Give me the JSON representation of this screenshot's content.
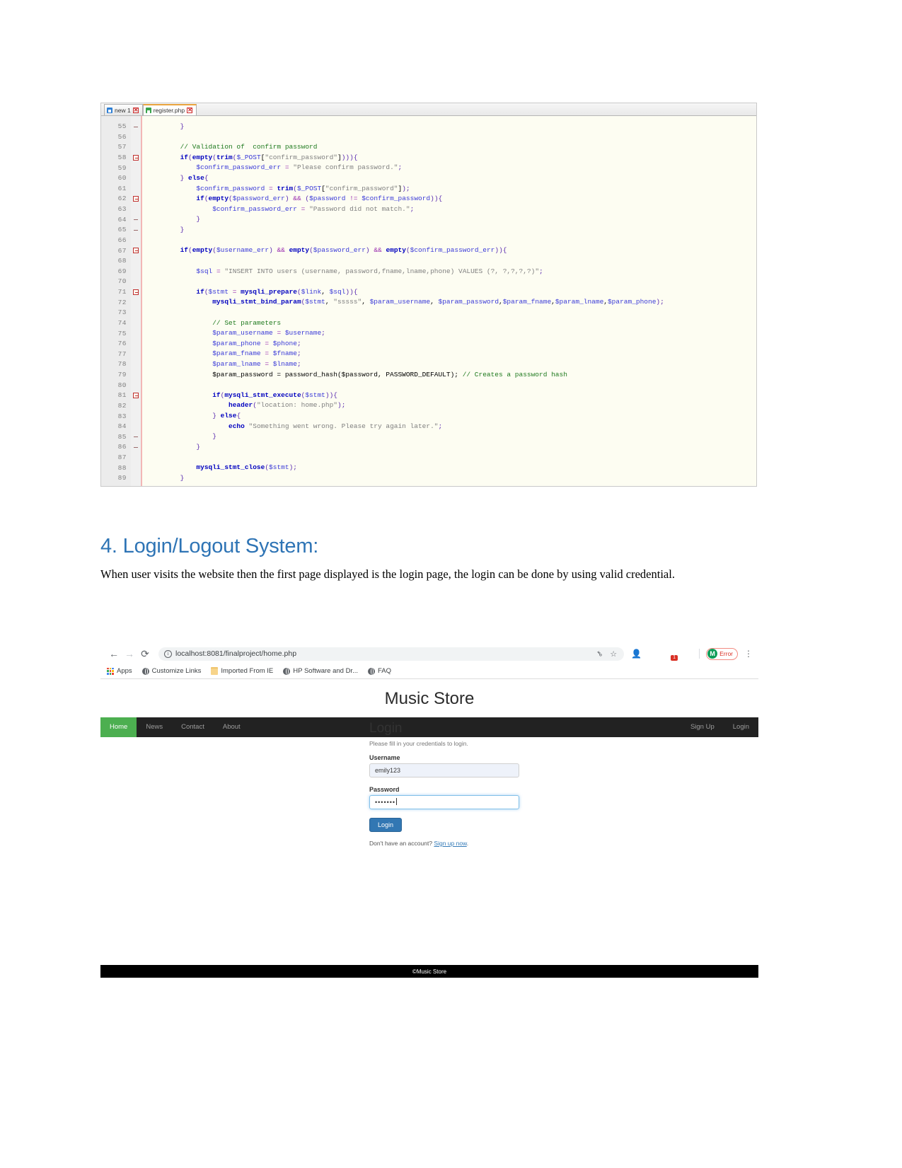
{
  "editor": {
    "tabs": [
      {
        "label": "new 1",
        "active": false,
        "close": "✕"
      },
      {
        "label": "register.php",
        "active": true,
        "close": "✕"
      }
    ],
    "first_line_number": 55,
    "last_line_number": 89,
    "lines": [
      {
        "n": 55,
        "fold": "end",
        "text": "        }"
      },
      {
        "n": 56,
        "fold": "",
        "text": ""
      },
      {
        "n": 57,
        "fold": "",
        "text": "        // Validation of  confirm password"
      },
      {
        "n": 58,
        "fold": "open",
        "text": "        if(empty(trim($_POST[\"confirm_password\"]))){"
      },
      {
        "n": 59,
        "fold": "",
        "text": "            $confirm_password_err = \"Please confirm password.\";"
      },
      {
        "n": 60,
        "fold": "",
        "text": "        } else{"
      },
      {
        "n": 61,
        "fold": "",
        "text": "            $confirm_password = trim($_POST[\"confirm_password\"]);"
      },
      {
        "n": 62,
        "fold": "open",
        "text": "            if(empty($password_err) && ($password != $confirm_password)){"
      },
      {
        "n": 63,
        "fold": "",
        "text": "                $confirm_password_err = \"Password did not match.\";"
      },
      {
        "n": 64,
        "fold": "end",
        "text": "            }"
      },
      {
        "n": 65,
        "fold": "end",
        "text": "        }"
      },
      {
        "n": 66,
        "fold": "",
        "text": ""
      },
      {
        "n": 67,
        "fold": "open",
        "text": "        if(empty($username_err) && empty($password_err) && empty($confirm_password_err)){"
      },
      {
        "n": 68,
        "fold": "",
        "text": ""
      },
      {
        "n": 69,
        "fold": "",
        "text": "            $sql = \"INSERT INTO users (username, password,fname,lname,phone) VALUES (?, ?,?,?,?)\";"
      },
      {
        "n": 70,
        "fold": "",
        "text": ""
      },
      {
        "n": 71,
        "fold": "open",
        "text": "            if($stmt = mysqli_prepare($link, $sql)){"
      },
      {
        "n": 72,
        "fold": "",
        "text": "                mysqli_stmt_bind_param($stmt, \"sssss\", $param_username, $param_password,$param_fname,$param_lname,$param_phone);"
      },
      {
        "n": 73,
        "fold": "",
        "text": ""
      },
      {
        "n": 74,
        "fold": "",
        "text": "                // Set parameters"
      },
      {
        "n": 75,
        "fold": "",
        "text": "                $param_username = $username;"
      },
      {
        "n": 76,
        "fold": "",
        "text": "                $param_phone = $phone;"
      },
      {
        "n": 77,
        "fold": "",
        "text": "                $param_fname = $fname;"
      },
      {
        "n": 78,
        "fold": "",
        "text": "                $param_lname = $lname;"
      },
      {
        "n": 79,
        "fold": "",
        "text": "                $param_password = password_hash($password, PASSWORD_DEFAULT); // Creates a password hash"
      },
      {
        "n": 80,
        "fold": "",
        "text": ""
      },
      {
        "n": 81,
        "fold": "open",
        "text": "                if(mysqli_stmt_execute($stmt)){"
      },
      {
        "n": 82,
        "fold": "",
        "text": "                    header(\"location: home.php\");"
      },
      {
        "n": 83,
        "fold": "",
        "text": "                } else{"
      },
      {
        "n": 84,
        "fold": "",
        "text": "                    echo \"Something went wrong. Please try again later.\";"
      },
      {
        "n": 85,
        "fold": "end",
        "text": "                }"
      },
      {
        "n": 86,
        "fold": "end",
        "text": "            }"
      },
      {
        "n": 87,
        "fold": "",
        "text": ""
      },
      {
        "n": 88,
        "fold": "",
        "text": "            mysqli_stmt_close($stmt);"
      },
      {
        "n": 89,
        "fold": "",
        "text": "        }"
      }
    ]
  },
  "document": {
    "heading": "4. Login/Logout System:",
    "paragraph": "When user visits the website then the first page displayed is the login page, the login can be done by using valid credential.",
    "heading_color": "#2e74b5"
  },
  "browser": {
    "back_icon": "←",
    "forward_icon": "→",
    "reload_icon": "⟳",
    "url": "localhost:8081/finalproject/home.php",
    "info_icon_label": "i",
    "key_icon": "⚷",
    "star_icon": "☆",
    "menu_icon": "⋮",
    "profile": {
      "initial": "M",
      "label": "Error"
    },
    "extension_badge_count": "1",
    "bookmarks": [
      {
        "label": "Apps",
        "icon": "apps-grid-icon"
      },
      {
        "label": "Customize Links",
        "icon": "globe-icon"
      },
      {
        "label": "Imported From IE",
        "icon": "folder-icon"
      },
      {
        "label": "HP Software and Dr...",
        "icon": "globe-icon"
      },
      {
        "label": "FAQ",
        "icon": "globe-icon"
      }
    ]
  },
  "site": {
    "title": "Music Store",
    "nav_left": [
      "Home",
      "News",
      "Contact",
      "About"
    ],
    "nav_active": "Home",
    "nav_right": [
      "Sign Up",
      "Login"
    ],
    "nav_active_color": "#4caf50",
    "login": {
      "heading": "Login",
      "subtitle": "Please fill in your credentials to login.",
      "username_label": "Username",
      "username_value": "emily123",
      "password_label": "Password",
      "password_value": "•••••••",
      "submit_label": "Login",
      "signup_prompt": "Don't have an account?",
      "signup_link": "Sign up now",
      "signup_period": ".",
      "button_color": "#3277b3"
    },
    "footer": "©Music Store"
  }
}
